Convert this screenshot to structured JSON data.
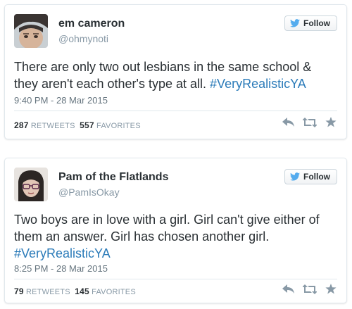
{
  "tweets": [
    {
      "name": "em cameron",
      "handle": "@ohmynoti",
      "follow_label": "Follow",
      "text_before": "There are only two out lesbians in the same school & they aren't each other's type at all. ",
      "hashtag": "#VeryRealisticYA",
      "time": "9:40 PM - 28 Mar 2015",
      "retweets": "287",
      "retweets_label": "RETWEETS",
      "favorites": "557",
      "favorites_label": "FAVORITES"
    },
    {
      "name": "Pam of the Flatlands",
      "handle": "@PamIsOkay",
      "follow_label": "Follow",
      "text_before": "Two boys are in love with a girl. Girl can't give either of them an answer. Girl has chosen another girl. ",
      "hashtag": "#VeryRealisticYA",
      "time": "8:25 PM - 28 Mar 2015",
      "retweets": "79",
      "retweets_label": "RETWEETS",
      "favorites": "145",
      "favorites_label": "FAVORITES"
    }
  ],
  "icons": {
    "bird": "twitter-bird-icon",
    "reply": "reply-icon",
    "retweet": "retweet-icon",
    "favorite": "star-icon"
  },
  "colors": {
    "link": "#2b7bb9",
    "bird": "#55acee",
    "icon": "#8899a6"
  }
}
